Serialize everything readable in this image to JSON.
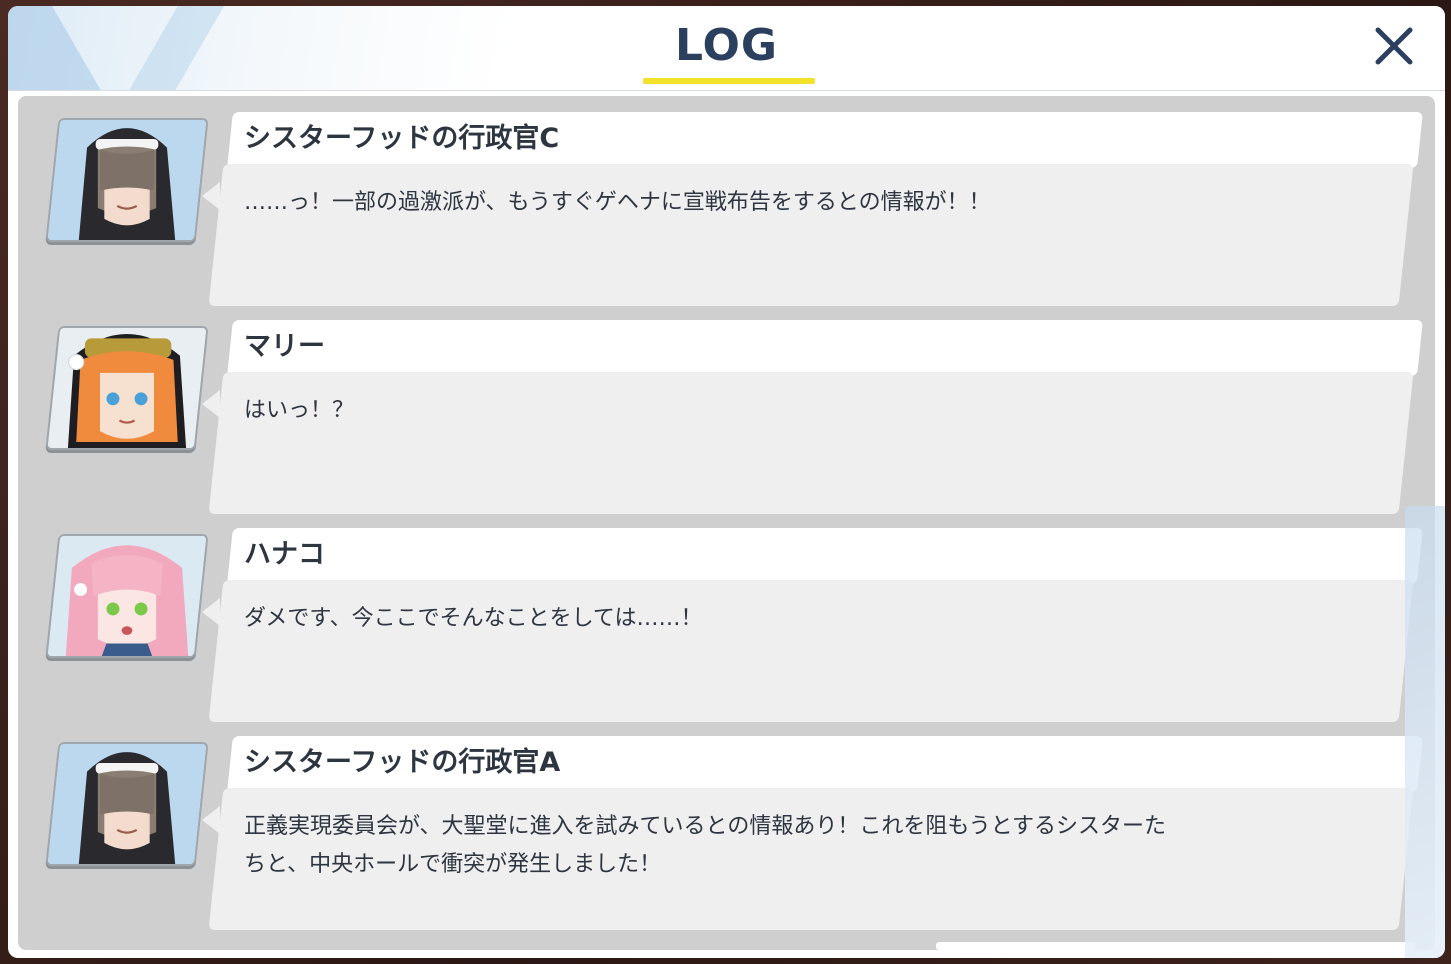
{
  "header": {
    "title": "LOG",
    "close_icon": "close-icon"
  },
  "colors": {
    "title": "#2b3f5f",
    "underline": "#f2e22a",
    "list_background": "#cfcfcf",
    "bubble": "#efefef",
    "name_bar": "#ffffff",
    "text": "#2d3540"
  },
  "entries": [
    {
      "speaker": "シスターフッドの行政官C",
      "text": "……っ！一部の過激派が、もうすぐゲヘナに宣戦布告をするとの情報が！！",
      "portrait_icon": "nun-administrator-portrait"
    },
    {
      "speaker": "マリー",
      "text": "はいっ！？",
      "portrait_icon": "mari-portrait"
    },
    {
      "speaker": "ハナコ",
      "text": "ダメです、今ここでそんなことをしては……！",
      "portrait_icon": "hanako-portrait"
    },
    {
      "speaker": "シスターフッドの行政官A",
      "text": "正義実現委員会が、大聖堂に進入を試みているとの情報あり！これを阻もうとするシスターた\nちと、中央ホールで衝突が発生しました！",
      "portrait_icon": "nun-administrator-portrait"
    }
  ]
}
